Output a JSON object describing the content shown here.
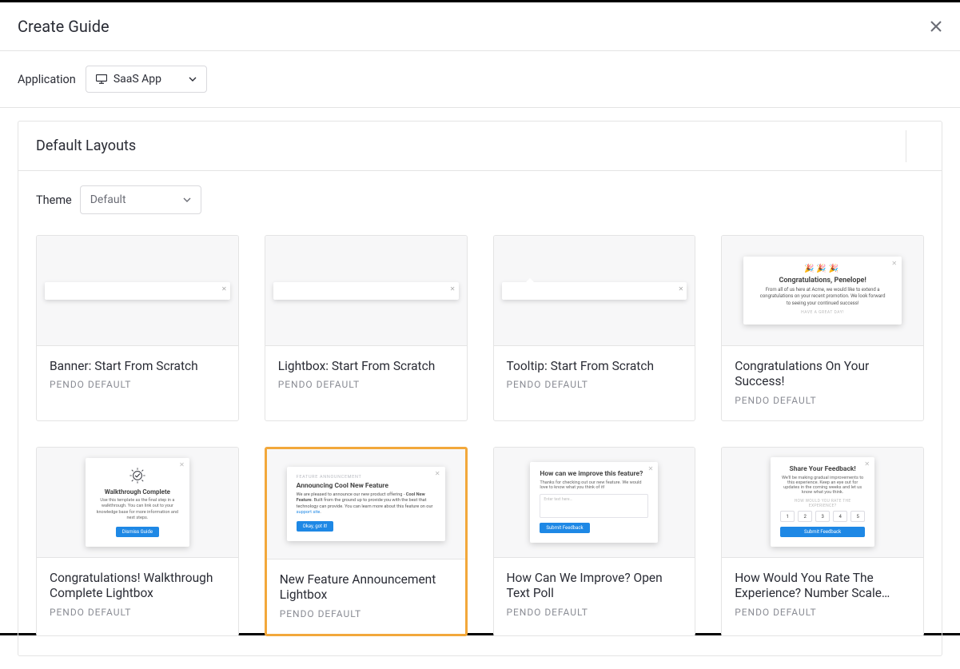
{
  "modal": {
    "title": "Create Guide"
  },
  "application": {
    "label": "Application",
    "selected": "SaaS App"
  },
  "panel": {
    "title": "Default Layouts",
    "theme_label": "Theme",
    "theme_selected": "Default"
  },
  "cards": [
    {
      "title": "Banner: Start From Scratch",
      "subtitle": "PENDO DEFAULT"
    },
    {
      "title": "Lightbox: Start From Scratch",
      "subtitle": "PENDO DEFAULT"
    },
    {
      "title": "Tooltip: Start From Scratch",
      "subtitle": "PENDO DEFAULT"
    },
    {
      "title": "Congratulations On Your Success!",
      "subtitle": "PENDO DEFAULT"
    },
    {
      "title": "Congratulations! Walkthrough Complete Lightbox",
      "subtitle": "PENDO DEFAULT"
    },
    {
      "title": "New Feature Announcement Lightbox",
      "subtitle": "PENDO DEFAULT"
    },
    {
      "title": "How Can We Improve? Open Text Poll",
      "subtitle": "PENDO DEFAULT"
    },
    {
      "title": "How Would You Rate The Experience? Number Scale…",
      "subtitle": "PENDO DEFAULT"
    }
  ],
  "thumbs": {
    "congrats": {
      "title": "Congratulations, Penelope!",
      "body": "From all of us here at Acme, we would like to extend a congratulations on your recent promotion. We look forward to seeing your continued success!",
      "foot": "HAVE A GREAT DAY!"
    },
    "walkthrough": {
      "title": "Walkthrough Complete",
      "body": "Use this template as the final step in a walkthrough. You can link out to your knowledge base for more information and next steps.",
      "button": "Dismiss Guide"
    },
    "feature": {
      "eyebrow": "FEATURE ANNOUNCEMENT",
      "title": "Announcing Cool New Feature",
      "body_pre": "We are pleased to announce our new product offering - ",
      "body_bold": "Cool New Feature",
      "body_post": ". Built from the ground up to provide you with the best that technology can provide. You can learn more about this feature on our ",
      "body_link": "support site",
      "button": "Okay, got it!"
    },
    "improve": {
      "title": "How can we improve this feature?",
      "body": "Thanks for checking out our new feature. We would love to know what you think of it!",
      "placeholder": "Enter text here…",
      "button": "Submit Feedback"
    },
    "rate": {
      "title": "Share Your Feedback!",
      "body": "We'll be making gradual improvements to this experience. Keep an eye out for updates in the coming weeks and let us know what you think.",
      "foot": "HOW WOULD YOU RATE THE EXPERIENCE?",
      "n1": "1",
      "n2": "2",
      "n3": "3",
      "n4": "4",
      "n5": "5",
      "button": "Submit Feedback"
    }
  }
}
